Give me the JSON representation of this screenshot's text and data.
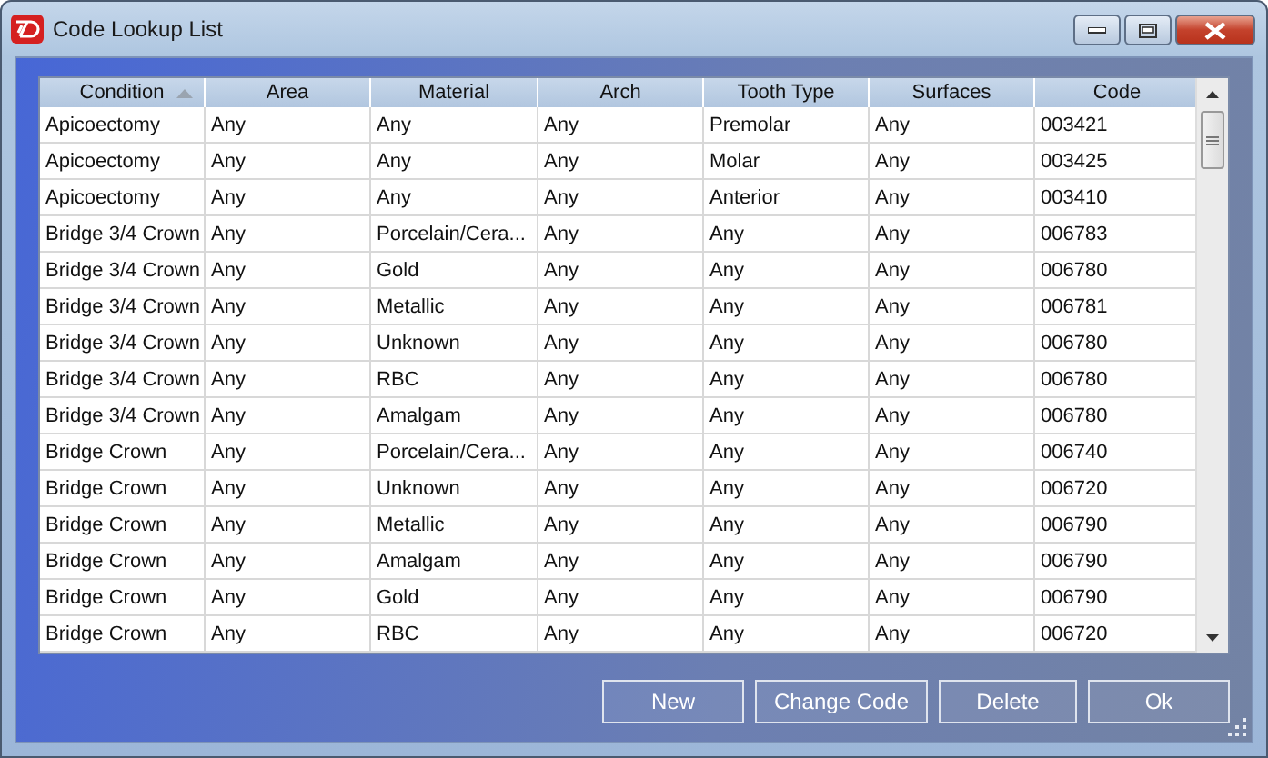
{
  "window": {
    "title": "Code Lookup List"
  },
  "table": {
    "columns": [
      {
        "label": "Condition",
        "sorted": true
      },
      {
        "label": "Area",
        "sorted": false
      },
      {
        "label": "Material",
        "sorted": false
      },
      {
        "label": "Arch",
        "sorted": false
      },
      {
        "label": "Tooth Type",
        "sorted": false
      },
      {
        "label": "Surfaces",
        "sorted": false
      },
      {
        "label": "Code",
        "sorted": false
      }
    ],
    "rows": [
      [
        "Apicoectomy",
        "Any",
        "Any",
        "Any",
        "Premolar",
        "Any",
        "003421"
      ],
      [
        "Apicoectomy",
        "Any",
        "Any",
        "Any",
        "Molar",
        "Any",
        "003425"
      ],
      [
        "Apicoectomy",
        "Any",
        "Any",
        "Any",
        "Anterior",
        "Any",
        "003410"
      ],
      [
        "Bridge 3/4 Crown",
        "Any",
        "Porcelain/Cera...",
        "Any",
        "Any",
        "Any",
        "006783"
      ],
      [
        "Bridge 3/4 Crown",
        "Any",
        "Gold",
        "Any",
        "Any",
        "Any",
        "006780"
      ],
      [
        "Bridge 3/4 Crown",
        "Any",
        "Metallic",
        "Any",
        "Any",
        "Any",
        "006781"
      ],
      [
        "Bridge 3/4 Crown",
        "Any",
        "Unknown",
        "Any",
        "Any",
        "Any",
        "006780"
      ],
      [
        "Bridge 3/4 Crown",
        "Any",
        "RBC",
        "Any",
        "Any",
        "Any",
        "006780"
      ],
      [
        "Bridge 3/4 Crown",
        "Any",
        "Amalgam",
        "Any",
        "Any",
        "Any",
        "006780"
      ],
      [
        "Bridge Crown",
        "Any",
        "Porcelain/Cera...",
        "Any",
        "Any",
        "Any",
        "006740"
      ],
      [
        "Bridge Crown",
        "Any",
        "Unknown",
        "Any",
        "Any",
        "Any",
        "006720"
      ],
      [
        "Bridge Crown",
        "Any",
        "Metallic",
        "Any",
        "Any",
        "Any",
        "006790"
      ],
      [
        "Bridge Crown",
        "Any",
        "Amalgam",
        "Any",
        "Any",
        "Any",
        "006790"
      ],
      [
        "Bridge Crown",
        "Any",
        "Gold",
        "Any",
        "Any",
        "Any",
        "006790"
      ],
      [
        "Bridge Crown",
        "Any",
        "RBC",
        "Any",
        "Any",
        "Any",
        "006720"
      ]
    ]
  },
  "buttons": [
    "New",
    "Change Code",
    "Delete",
    "Ok"
  ]
}
